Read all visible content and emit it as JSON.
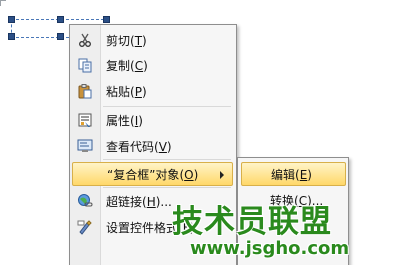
{
  "menu": {
    "items": [
      {
        "label": "剪切",
        "accel": "T",
        "icon": "scissors-icon"
      },
      {
        "label": "复制",
        "accel": "C",
        "icon": "copy-icon"
      },
      {
        "label": "粘贴",
        "accel": "P",
        "icon": "paste-icon"
      },
      {
        "label": "属性",
        "accel": "I",
        "icon": "properties-icon"
      },
      {
        "label": "查看代码",
        "accel": "V",
        "icon": "view-code-icon"
      },
      {
        "label": "“复合框”对象",
        "accel": "O",
        "icon": ""
      },
      {
        "label": "超链接",
        "accel": "H",
        "icon": "hyperlink-icon"
      },
      {
        "label": "设置控件格式",
        "accel": "F",
        "icon": "format-control-icon"
      }
    ]
  },
  "submenu": {
    "items": [
      {
        "label": "编辑",
        "accel": "E"
      },
      {
        "label": "转换",
        "accel": "C"
      }
    ]
  },
  "watermark": {
    "title": "技术员联盟",
    "url": "www.jsgho.com"
  },
  "colors": {
    "highlight": "#ffd86a",
    "watermark": "#2a8a1d",
    "selection_border": "#4a78b8"
  }
}
